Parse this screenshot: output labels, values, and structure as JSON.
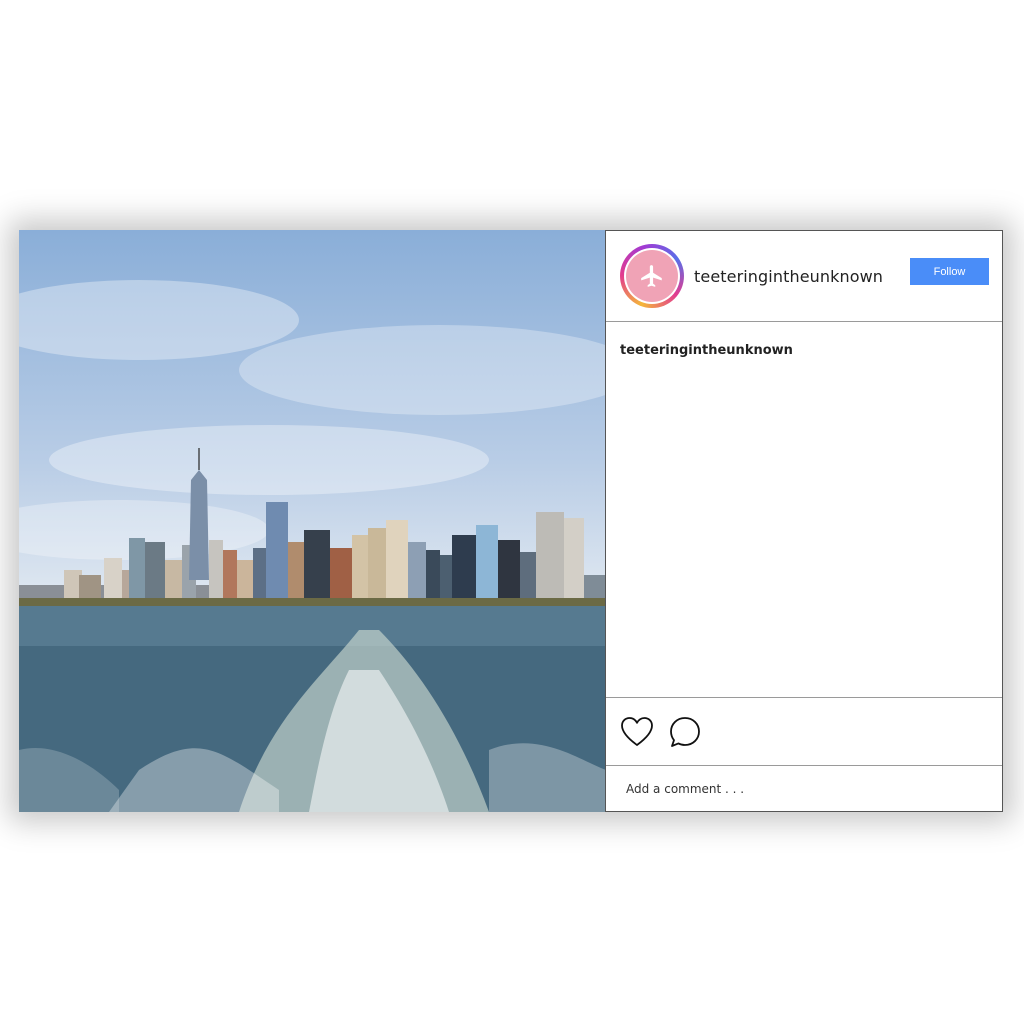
{
  "post": {
    "username": "teeteringintheunknown",
    "follow_label": "Follow",
    "caption_username": "teeteringintheunknown",
    "comment_placeholder": "Add a comment . . .",
    "avatar_icon": "airplane-icon",
    "like_icon": "heart-icon",
    "comment_icon": "speech-bubble-icon",
    "photo_subject": "city-skyline-photo"
  },
  "colors": {
    "follow_button": "#4a8df8",
    "avatar_fill": "#f0a3b6"
  }
}
